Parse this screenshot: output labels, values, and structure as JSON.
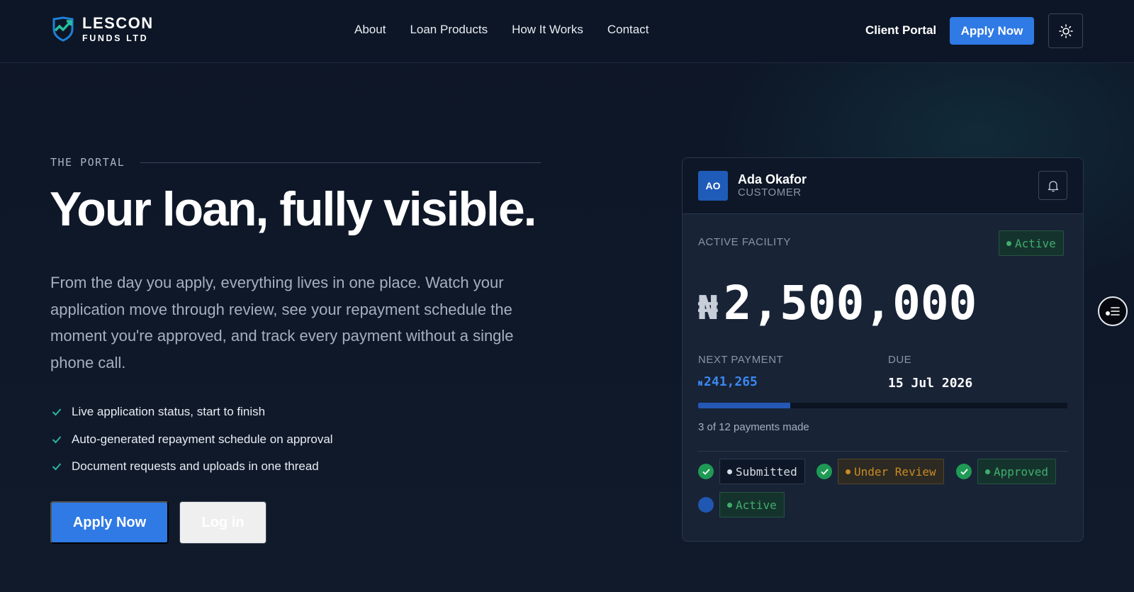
{
  "brand": {
    "name_line1": "LESCON",
    "name_line2": "FUNDS LTD"
  },
  "nav": {
    "items": [
      "About",
      "Loan Products",
      "How It Works",
      "Contact"
    ]
  },
  "header": {
    "client_portal": "Client Portal",
    "apply_label": "Apply Now",
    "theme_icon": "sun-icon"
  },
  "hero": {
    "eyebrow": "THE PORTAL",
    "title": "Your loan, fully visible.",
    "description": "From the day you apply, everything lives in one place. Watch your application move through review, see your repayment schedule the moment you're approved, and track every payment without a single phone call.",
    "features": [
      "Live application status, start to finish",
      "Auto-generated repayment schedule on approval",
      "Document requests and uploads in one thread"
    ],
    "apply_label": "Apply Now",
    "login_label": "Log in"
  },
  "card": {
    "avatar_initials": "AO",
    "user_name": "Ada Okafor",
    "user_role": "CUSTOMER",
    "facility_label": "ACTIVE FACILITY",
    "facility_status": "Active",
    "currency_symbol": "₦",
    "amount": "2,500,000",
    "next_payment_label": "NEXT PAYMENT",
    "next_payment_currency": "₦",
    "next_payment_amount": "241,265",
    "due_label": "DUE",
    "due_date": "15 Jul 2026",
    "payments_made": 3,
    "payments_total": 12,
    "progress_text": "3 of 12 payments made",
    "steps": [
      {
        "label": "Submitted",
        "done": true,
        "tone": "grey"
      },
      {
        "label": "Under Review",
        "done": true,
        "tone": "amber"
      },
      {
        "label": "Approved",
        "done": true,
        "tone": "green"
      },
      {
        "label": "Active",
        "done": false,
        "tone": "green"
      }
    ]
  },
  "colors": {
    "accent": "#2f7ae5",
    "success": "#3fae6d",
    "warning": "#c98a25",
    "background": "#0d1626",
    "card": "#182336"
  }
}
